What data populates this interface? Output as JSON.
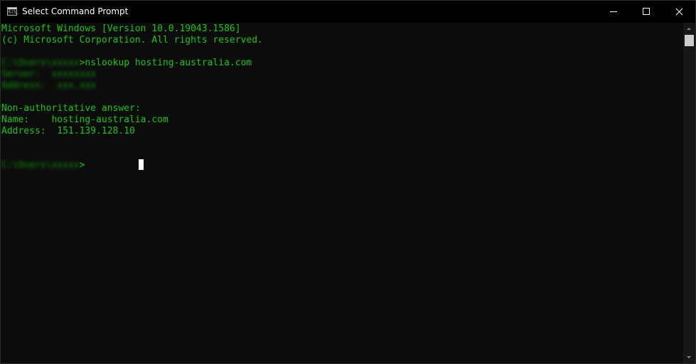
{
  "window": {
    "title": "Select Command Prompt",
    "icon": "cmd-icon",
    "icon_text": "C:\\_"
  },
  "colors": {
    "console_text": "#16c60c",
    "console_background": "#0c0c0c",
    "titlebar_background": "#000000",
    "cursor": "#ffffff"
  },
  "console": {
    "header_line_1": "Microsoft Windows [Version 10.0.19043.1586]",
    "header_line_2": "(c) Microsoft Corporation. All rights reserved.",
    "prompt_1": "C:\\Users\\xxxxx",
    "command_1": ">nslookup hosting-australia.com",
    "server_line": "Server:  xxxxxxxx",
    "server_address_line": "Address:  xxx.xxx",
    "non_auth": "Non-authoritative answer:",
    "name_line": "Name:    hosting-australia.com",
    "address_line": "Address:  151.139.128.10",
    "prompt_2": "C:\\Users\\xxxxx",
    "prompt_2_suffix": ">"
  },
  "scrollbar": {
    "up_icon": "scroll-up-icon",
    "down_icon": "scroll-down-icon"
  }
}
